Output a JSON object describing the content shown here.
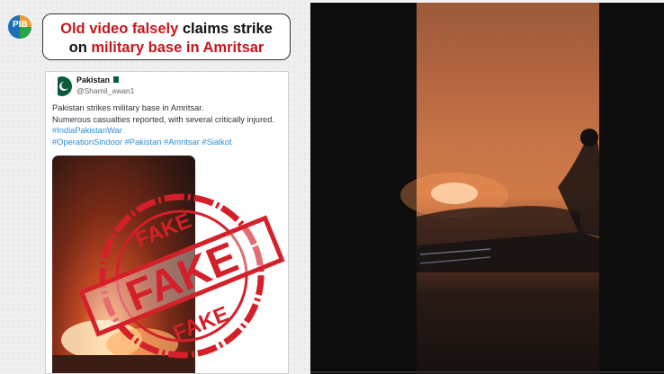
{
  "headline": {
    "part1_red": "Old video falsely",
    "part2_black": " claims strike",
    "part3_black": "on ",
    "part4_red": "military base in Amritsar"
  },
  "logo": {
    "text": "PIB"
  },
  "tweet": {
    "user_name": "Pakistan",
    "handle": "@Shamil_awan1",
    "lines": [
      "Pakistan strikes military base in Amritsar.",
      "Numerous casualties reported, with several critically injured."
    ],
    "tag_lines": [
      "#IndiaPakistanWar",
      "#OperationSindoor #Pakistan #Amritsar #Sialkot"
    ]
  },
  "stamp": {
    "top_text": "FAKE",
    "center_text": "FAKE",
    "bottom_text": "FAKE",
    "color": "#d42028"
  },
  "colors": {
    "accent_red": "#c8161d",
    "link_blue": "#2c8fd9"
  }
}
